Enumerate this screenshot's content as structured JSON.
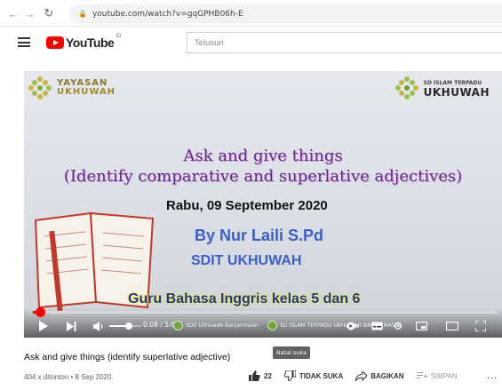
{
  "browser": {
    "url": "youtube.com/watch?v=gqGPHB06h-E"
  },
  "youtube": {
    "logo_text": "YouTube",
    "logo_suffix": "ID",
    "search_placeholder": "Telusuri"
  },
  "video_frame": {
    "left_logo": {
      "line1": "YAYASAN",
      "line2": "UKHUWAH"
    },
    "right_logo": {
      "line1": "SD ISLAM TERPADU",
      "line2": "UKHUWAH"
    },
    "title_line1": "Ask and give things",
    "title_line2": "(Identify comparative and superlative adjectives)",
    "date": "Rabu, 09 September 2020",
    "author": "By Nur Laili S.Pd",
    "school": "SDIT UKHUWAH",
    "teacher_line": "Guru Bahasa Inggris kelas 5 dan 6"
  },
  "player": {
    "time": "0:08 / 5:05",
    "progress": 0.016,
    "volume": 0.6,
    "chip1": "SDit Ukhuwah Banjarmasin",
    "chip2": "SD ISLAM TERPADU UKHUWAH BANJARMASIN"
  },
  "video_info": {
    "title": "Ask and give things (identify superlative adjective)",
    "meta": "404 x ditonton • 8 Sep 2020",
    "tooltip": "Batal suka",
    "like_count": "22",
    "dislike_label": "TIDAK SUKA",
    "share_label": "BAGIKAN",
    "save_label": "SIMPAN",
    "more_label": "..."
  },
  "colors": {
    "youtube_red": "#ff0000",
    "title_purple": "#6a2a8a",
    "heading_blue": "#3c5fc6"
  }
}
